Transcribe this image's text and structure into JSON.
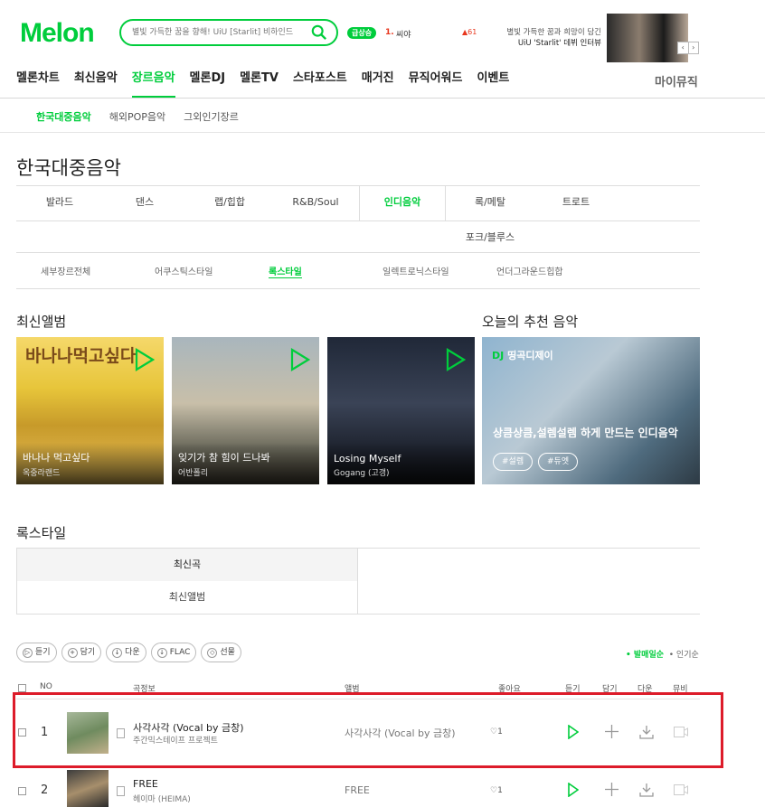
{
  "header": {
    "logo": "Melon",
    "search_placeholder": "별빛 가득한 꿈을 향해! UiU [Starlit] 비하인드",
    "rank_badge": "급상승",
    "rank_num": "1.",
    "rank_word": "씨야",
    "rank_delta": "▲61",
    "promo_line1": "별빛 가득한 꿈과 희망이 담긴",
    "promo_line2": "UiU 'Starlit' 데뷔 인터뷰",
    "promo_prev": "‹",
    "promo_next": "›"
  },
  "gnb": {
    "items": [
      "멜론차트",
      "최신음악",
      "장르음악",
      "멜론DJ",
      "멜론TV",
      "스타포스트",
      "매거진",
      "뮤직어워드",
      "이벤트"
    ],
    "active_index": 2,
    "my_music": "마이뮤직"
  },
  "subnav": {
    "items": [
      "한국대중음악",
      "해외POP음악",
      "그외인기장르"
    ],
    "active_index": 0
  },
  "page_title": "한국대중음악",
  "genres": {
    "row1": [
      "발라드",
      "댄스",
      "랩/힙합",
      "R&B/Soul",
      "인디음악",
      "록/메탈",
      "트로트"
    ],
    "active_index": 4,
    "row2": [
      "포크/블루스"
    ]
  },
  "styles": {
    "items": [
      "세부장르전체",
      "어쿠스틱스타일",
      "록스타일",
      "일렉트로닉스타일",
      "언더그라운드힙합"
    ],
    "active_index": 2
  },
  "latest_albums": {
    "title": "최신앨범",
    "items": [
      {
        "title": "바나나 먹고싶다",
        "artist": "옥중라랜드",
        "cover_text": "바나나먹고싶다"
      },
      {
        "title": "잊기가 참 힘이 드나봐",
        "artist": "어반폴리"
      },
      {
        "title": "Losing Myself",
        "artist": "Gogang (고갱)"
      }
    ]
  },
  "recommend": {
    "title": "오늘의 추천 음악",
    "badge_icon": "DJ",
    "badge": "띵곡디제이",
    "text": "상큼상큼,설렘설렘 하게 만드는 인디음악",
    "tags": [
      "#설렘",
      "#듀엣"
    ]
  },
  "list": {
    "title": "록스타일",
    "tabs": [
      "최신곡",
      "최신앨범"
    ],
    "buttons": [
      "듣기",
      "담기",
      "다운",
      "FLAC",
      "선물"
    ],
    "sort": [
      "발매일순",
      "인기순"
    ],
    "headers": {
      "no": "NO",
      "song": "곡정보",
      "album": "앨범",
      "like": "좋아요",
      "listen": "듣기",
      "add": "담기",
      "down": "다운",
      "mv": "뮤비"
    },
    "rows": [
      {
        "no": "1",
        "title": "사각사각 (Vocal by 금창)",
        "artist": "주간믹스테이프 프로젝트",
        "album": "사각사각 (Vocal by 금창)",
        "likes": "1"
      },
      {
        "no": "2",
        "title": "FREE",
        "artist": "헤이마 (HEIMA)",
        "album": "FREE",
        "likes": "1"
      }
    ]
  },
  "colors": {
    "brand": "#00cd3c",
    "highlight": "#dd1c2a"
  }
}
